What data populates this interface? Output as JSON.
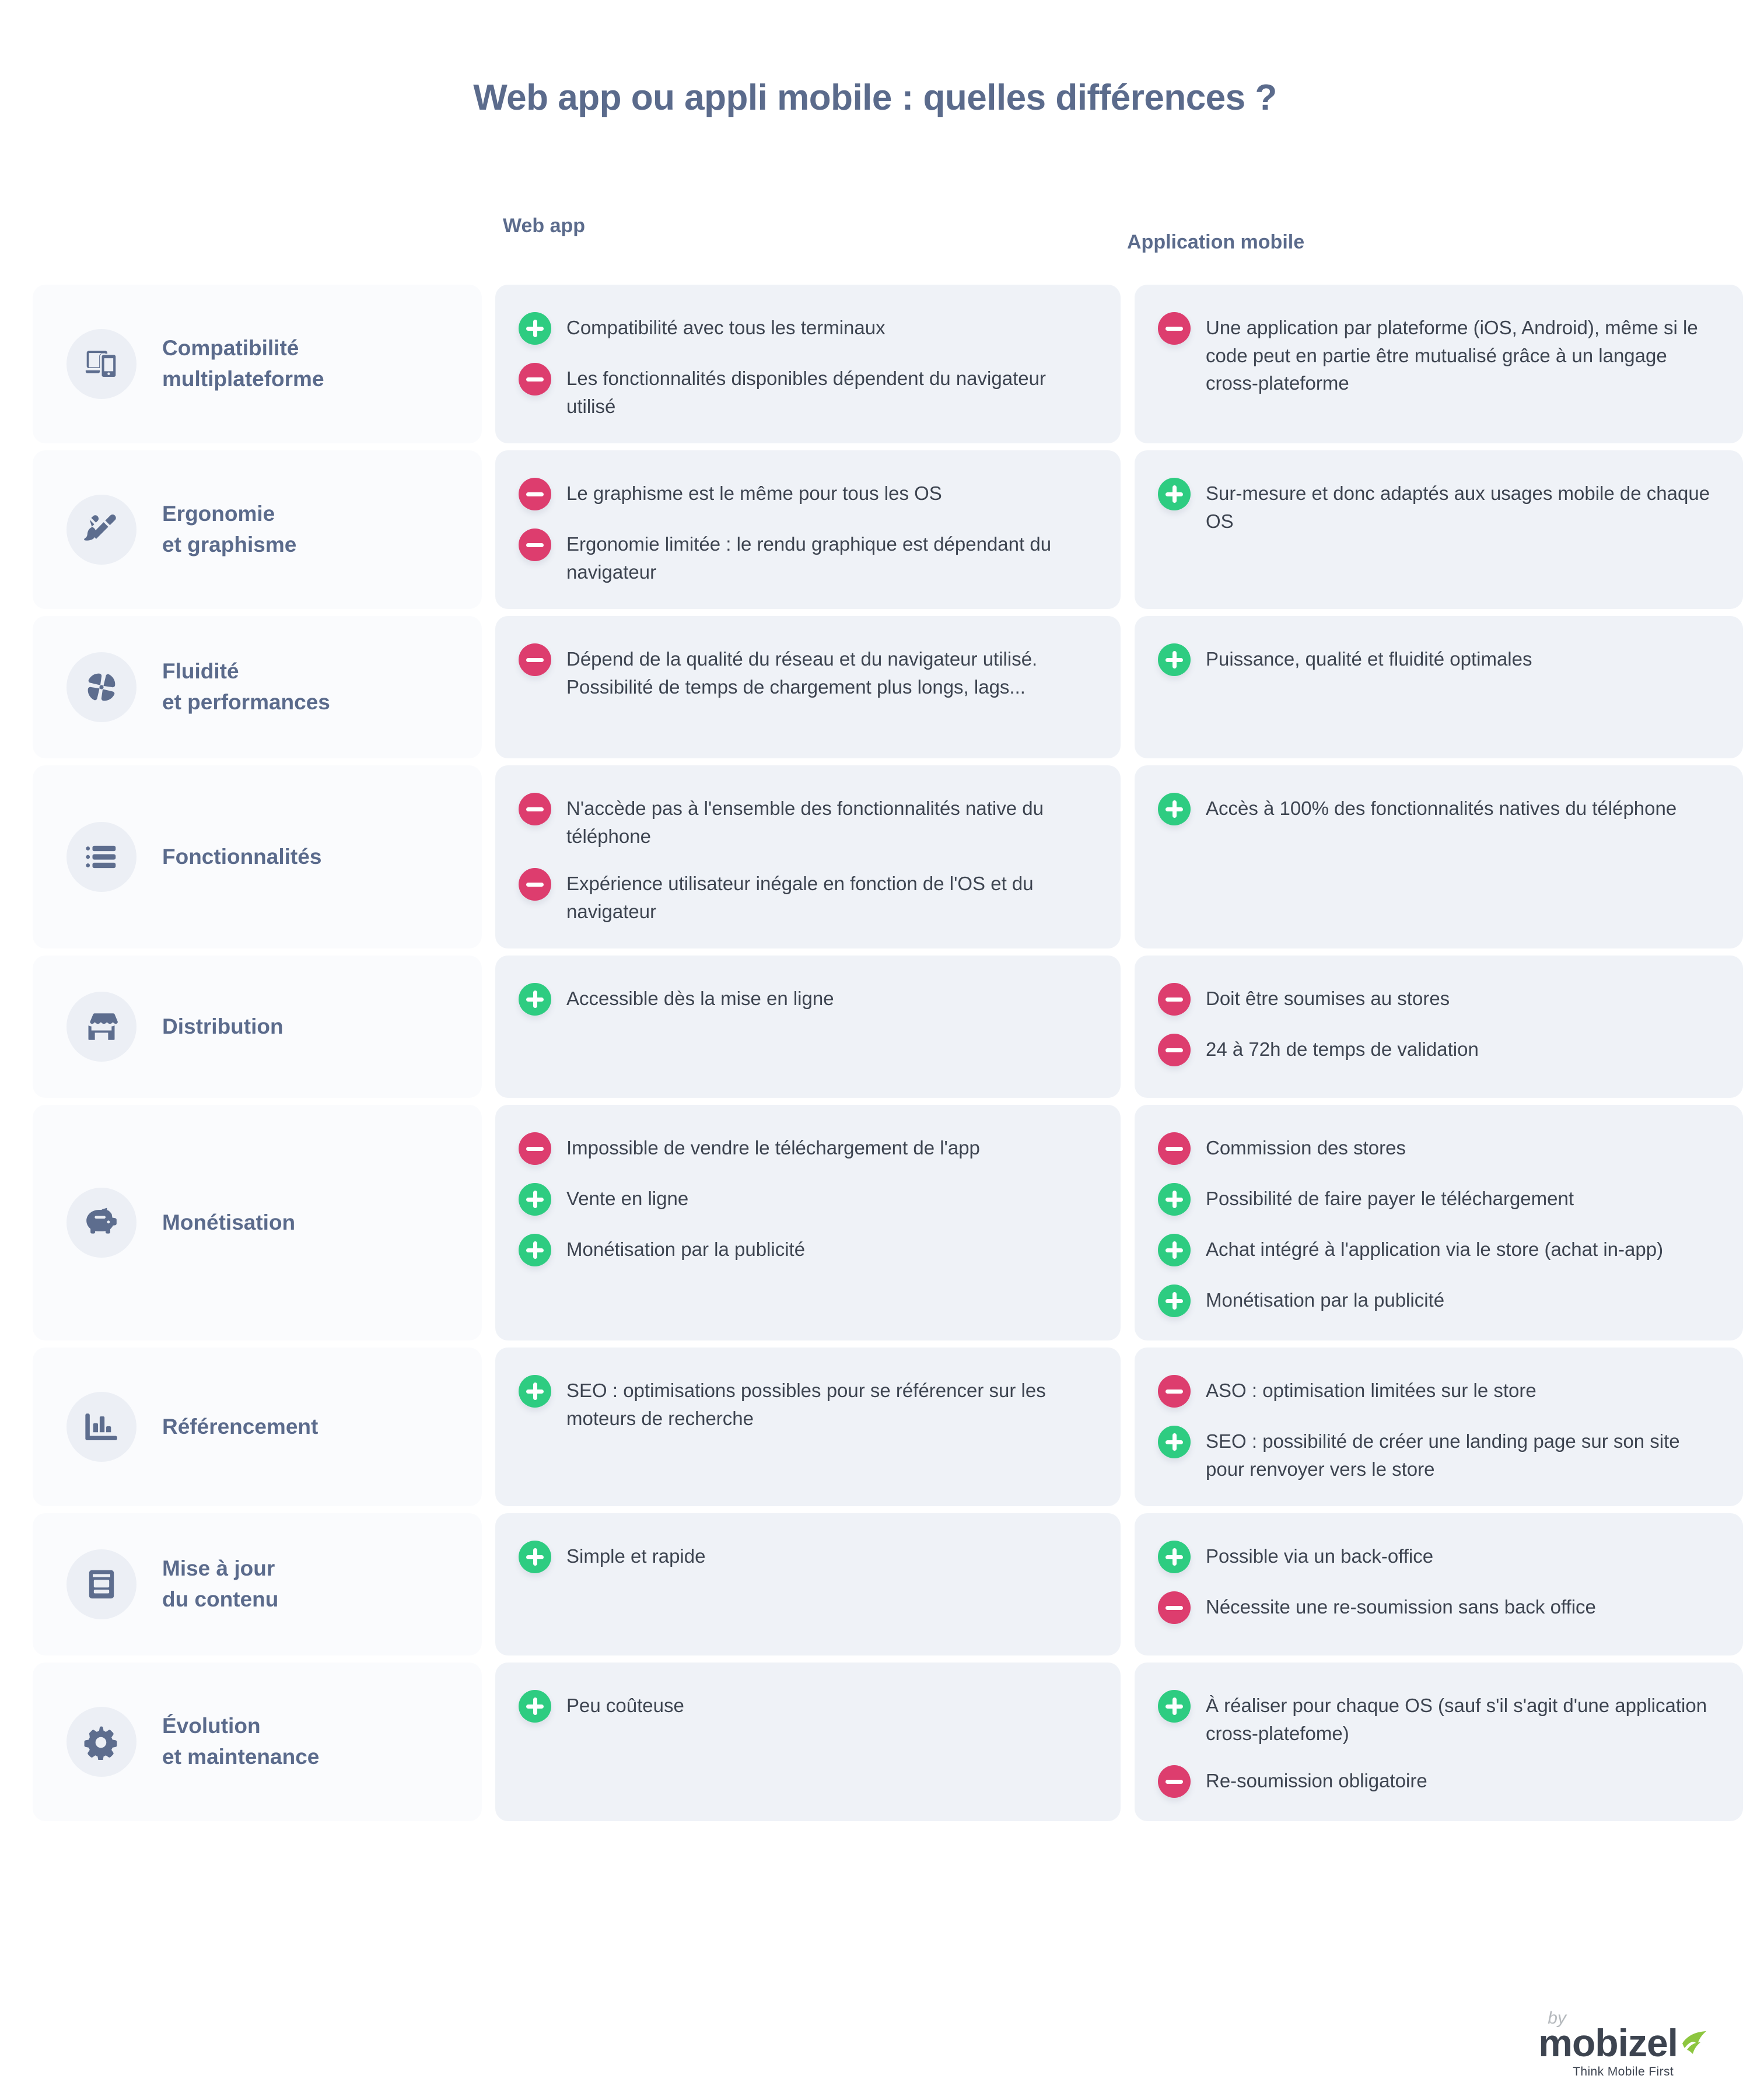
{
  "title": "Web app ou appli mobile : quelles différences ?",
  "columns": {
    "web": "Web app",
    "mobile": "Application mobile"
  },
  "colors": {
    "title": "#5b6b8c",
    "positive": "#2ecc81",
    "negative": "#dd3d6e",
    "label_card_bg": "#fafbfd",
    "list_card_bg": "#eff2f7",
    "icon_badge_bg": "#eceff5",
    "icon_fill": "#5d6d8e",
    "body_text": "#3d4450",
    "logo_accent": "#8dc63f"
  },
  "rows": [
    {
      "label": "Compatibilité\nmultiplateforme",
      "icon": "devices-icon",
      "web": [
        {
          "type": "plus",
          "text": "Compatibilité avec tous les terminaux"
        },
        {
          "type": "minus",
          "text": "Les fonctionnalités disponibles dépendent du navigateur utilisé"
        }
      ],
      "mobile": [
        {
          "type": "minus",
          "text": "Une application par plateforme (iOS, Android), même si le code peut en partie être mutualisé grâce à un langage cross-plateforme"
        }
      ]
    },
    {
      "label": "Ergonomie\net graphisme",
      "icon": "pen-brush-icon",
      "web": [
        {
          "type": "minus",
          "text": "Le graphisme est le même pour tous les OS"
        },
        {
          "type": "minus",
          "text": "Ergonomie limitée : le rendu graphique est dépendant du navigateur"
        }
      ],
      "mobile": [
        {
          "type": "plus",
          "text": "Sur-mesure et donc adaptés aux usages mobile de chaque OS"
        }
      ]
    },
    {
      "label": "Fluidité\net performances",
      "icon": "pinwheel-icon",
      "web": [
        {
          "type": "minus",
          "text": "Dépend de la qualité du réseau et du navigateur utilisé. Possibilité de temps de chargement plus longs, lags..."
        }
      ],
      "mobile": [
        {
          "type": "plus",
          "text": "Puissance, qualité et fluidité optimales"
        }
      ]
    },
    {
      "label": "Fonctionnalités",
      "icon": "list-icon",
      "web": [
        {
          "type": "minus",
          "text": "N'accède pas à l'ensemble des fonctionnalités native du téléphone"
        },
        {
          "type": "minus",
          "text": "Expérience utilisateur inégale en fonction de l'OS et du navigateur"
        }
      ],
      "mobile": [
        {
          "type": "plus",
          "text": "Accès à 100% des fonctionnalités natives du téléphone"
        }
      ]
    },
    {
      "label": "Distribution",
      "icon": "store-icon",
      "web": [
        {
          "type": "plus",
          "text": "Accessible dès la mise en ligne"
        }
      ],
      "mobile": [
        {
          "type": "minus",
          "text": "Doit être soumises au stores"
        },
        {
          "type": "minus",
          "text": "24 à 72h de temps de validation"
        }
      ]
    },
    {
      "label": "Monétisation",
      "icon": "piggy-bank-icon",
      "web": [
        {
          "type": "minus",
          "text": "Impossible de vendre le téléchargement de l'app"
        },
        {
          "type": "plus",
          "text": "Vente en ligne"
        },
        {
          "type": "plus",
          "text": "Monétisation par la publicité"
        }
      ],
      "mobile": [
        {
          "type": "minus",
          "text": "Commission des stores"
        },
        {
          "type": "plus",
          "text": "Possibilité de faire payer le téléchargement"
        },
        {
          "type": "plus",
          "text": "Achat intégré à l'application via le store (achat in-app)"
        },
        {
          "type": "plus",
          "text": "Monétisation par la publicité"
        }
      ]
    },
    {
      "label": "Référencement",
      "icon": "bar-chart-icon",
      "web": [
        {
          "type": "plus",
          "text": "SEO : optimisations possibles pour se référencer sur les moteurs de recherche"
        }
      ],
      "mobile": [
        {
          "type": "minus",
          "text": "ASO : optimisation limitées sur le store"
        },
        {
          "type": "plus",
          "text": "SEO : possibilité de créer une landing page sur son site pour renvoyer vers le store"
        }
      ]
    },
    {
      "label": "Mise à jour\ndu contenu",
      "icon": "document-icon",
      "web": [
        {
          "type": "plus",
          "text": "Simple et rapide"
        }
      ],
      "mobile": [
        {
          "type": "plus",
          "text": "Possible via un back-office"
        },
        {
          "type": "minus",
          "text": "Nécessite une re-soumission sans back office"
        }
      ]
    },
    {
      "label": "Évolution\net maintenance",
      "icon": "gear-icon",
      "web": [
        {
          "type": "plus",
          "text": "Peu coûteuse"
        }
      ],
      "mobile": [
        {
          "type": "plus",
          "text": "À réaliser pour chaque OS (sauf s'il s'agit d'une application cross-platefome)"
        },
        {
          "type": "minus",
          "text": "Re-soumission obligatoire"
        }
      ]
    }
  ],
  "logo": {
    "by": "by",
    "name": "mobizel",
    "tagline": "Think Mobile First"
  }
}
